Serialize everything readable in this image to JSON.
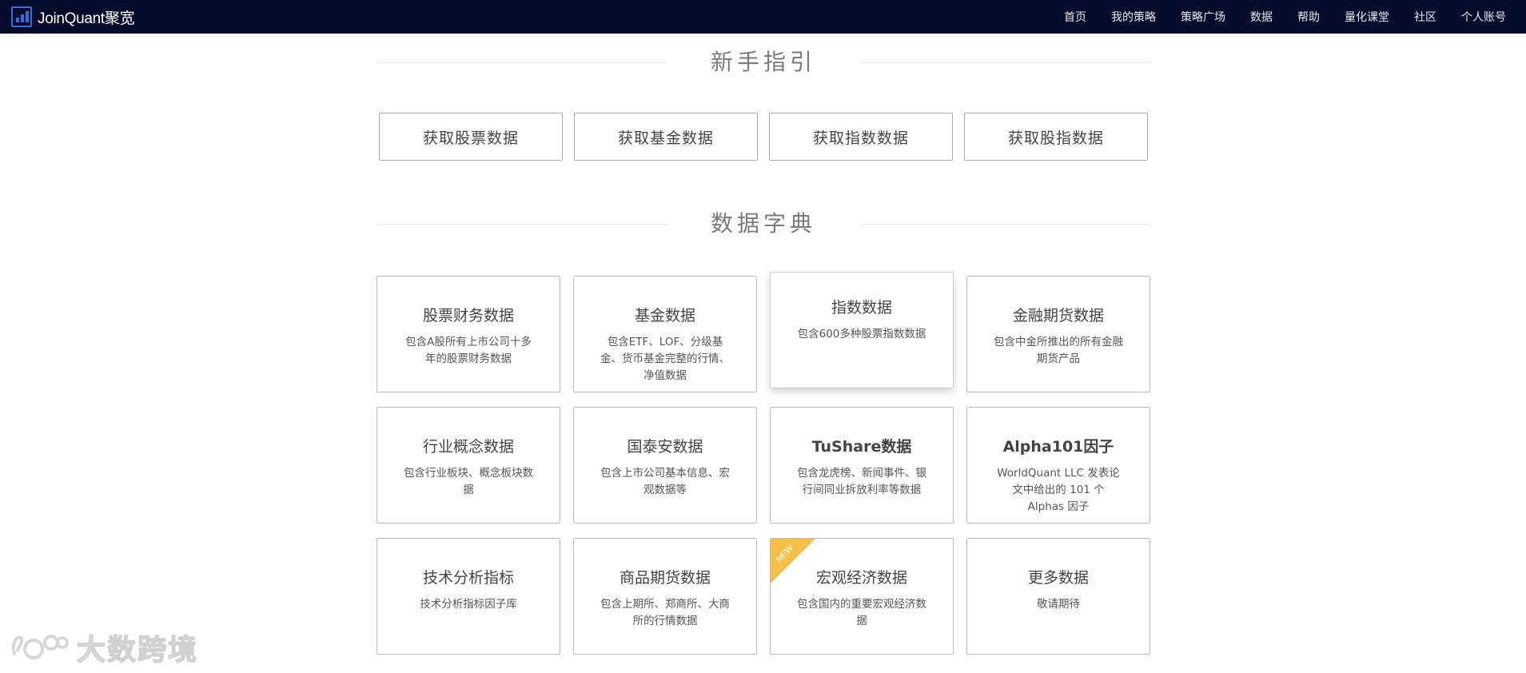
{
  "app": {
    "logo_text": "JoinQuant聚宽"
  },
  "nav": {
    "items": [
      "首页",
      "我的策略",
      "策略广场",
      "数据",
      "帮助",
      "量化课堂",
      "社区",
      "个人账号"
    ]
  },
  "guide": {
    "title": "新手指引",
    "buttons": [
      "获取股票数据",
      "获取基金数据",
      "获取指数数据",
      "获取股指数据"
    ]
  },
  "dictionary": {
    "title": "数据字典",
    "cards": [
      {
        "title": "股票财务数据",
        "desc": "包含A股所有上市公司十多年的股票财务数据"
      },
      {
        "title": "基金数据",
        "desc": "包含ETF、LOF、分级基金、货币基金完整的行情、净值数据"
      },
      {
        "title": "指数数据",
        "desc": "包含600多种股票指数数据"
      },
      {
        "title": "金融期货数据",
        "desc": "包含中金所推出的所有金融期货产品"
      },
      {
        "title": "行业概念数据",
        "desc": "包含行业板块、概念板块数据"
      },
      {
        "title": "国泰安数据",
        "desc": "包含上市公司基本信息、宏观数据等"
      },
      {
        "title": "TuShare数据",
        "desc": "包含龙虎榜、新闻事件、银行间同业拆放利率等数据"
      },
      {
        "title": "Alpha101因子",
        "desc": "WorldQuant LLC 发表论文中给出的 101 个 Alphas 因子"
      },
      {
        "title": "技术分析指标",
        "desc": "技术分析指标因子库"
      },
      {
        "title": "商品期货数据",
        "desc": "包含上期所、郑商所、大商所的行情数据"
      },
      {
        "title": "宏观经济数据",
        "desc": "包含国内的重要宏观经济数据",
        "badge": "NEW"
      },
      {
        "title": "更多数据",
        "desc": "敬请期待"
      }
    ]
  },
  "watermark": {
    "text": "大数跨境"
  },
  "colors": {
    "topbar": "#050b2a",
    "accent": "#2f6fe0",
    "badge": "#f5c04a"
  }
}
